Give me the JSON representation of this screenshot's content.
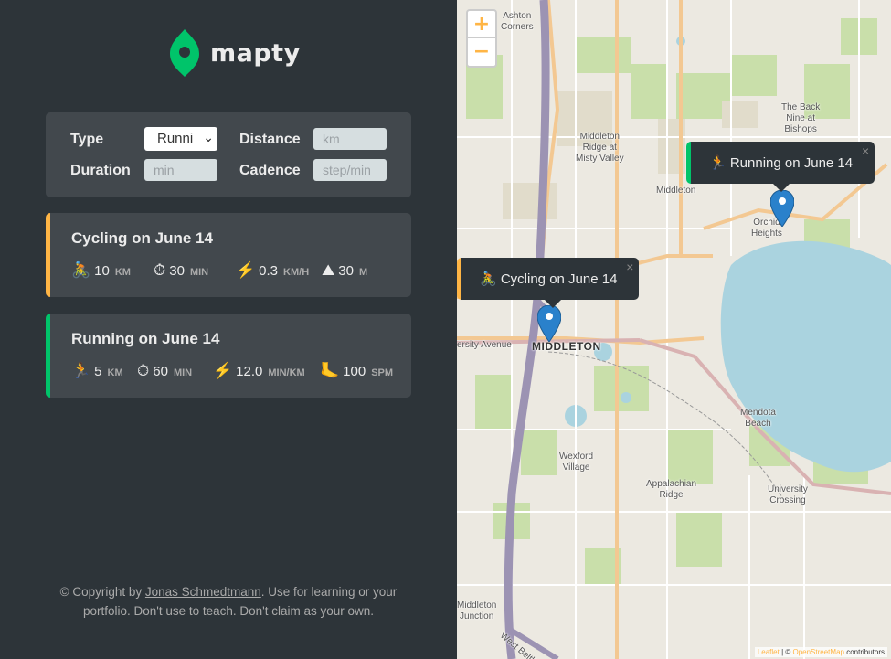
{
  "app": {
    "name": "mapty",
    "brand_color": "#00c46a",
    "accent_cycling": "#ffb545",
    "accent_running": "#00c46a"
  },
  "form": {
    "type_label": "Type",
    "type_value": "Runni",
    "distance_label": "Distance",
    "distance_placeholder": "km",
    "duration_label": "Duration",
    "duration_placeholder": "min",
    "cadence_label": "Cadence",
    "cadence_placeholder": "step/min"
  },
  "workouts": [
    {
      "title": "Cycling on June 14",
      "type": "cycling",
      "details": [
        {
          "icon": "🚴",
          "icon_name": "cyclist-icon",
          "value": "10",
          "unit": "km"
        },
        {
          "icon": "⏱",
          "icon_name": "stopwatch-icon",
          "value": "30",
          "unit": "min"
        },
        {
          "icon": "⚡",
          "icon_name": "lightning-icon",
          "value": "0.3",
          "unit": "km/h"
        },
        {
          "icon": "⛰",
          "icon_name": "mountain-icon",
          "value": "30",
          "unit": "m"
        }
      ]
    },
    {
      "title": "Running on June 14",
      "type": "running",
      "details": [
        {
          "icon": "🏃",
          "icon_name": "runner-icon",
          "value": "5",
          "unit": "km"
        },
        {
          "icon": "⏱",
          "icon_name": "stopwatch-icon",
          "value": "60",
          "unit": "min"
        },
        {
          "icon": "⚡",
          "icon_name": "lightning-icon",
          "value": "12.0",
          "unit": "min/km"
        },
        {
          "icon": "🦶",
          "icon_name": "foot-icon",
          "value": "100",
          "unit": "spm"
        }
      ]
    }
  ],
  "copyright": {
    "prefix": "© Copyright by ",
    "author": "Jonas Schmedtmann",
    "suffix": ". Use for learning or your portfolio. Don't use to teach. Don't claim as your own."
  },
  "map": {
    "zoom_in": "+",
    "zoom_out": "−",
    "popups": [
      {
        "text": "🏃 Running on June 14",
        "type": "running",
        "close": "×"
      },
      {
        "text": "🚴 Cycling on June 14",
        "type": "cycling",
        "close": "×"
      }
    ],
    "labels": {
      "ashton": "Ashton\nCorners",
      "middleton_ridge": "Middleton\nRidge at\nMisty Valley",
      "middleton_small": "Middleton",
      "back_nine": "The Back\nNine at\nBishops",
      "orchid": "Orchid\nHeights",
      "university_ave": "ersity Avenue",
      "middleton_city": "MIDDLETON",
      "mendota": "Mendota\nBeach",
      "wexford": "Wexford\nVillage",
      "appalachian": "Appalachian\nRidge",
      "university_crossing": "University\nCrossing",
      "middleton_junction": "Middleton\nJunction",
      "west_beltline": "West Beltline"
    },
    "attribution_leaflet": "Leaflet",
    "attribution_sep": " | © ",
    "attribution_osm": "OpenStreetMap",
    "attribution_suffix": " contributors"
  }
}
